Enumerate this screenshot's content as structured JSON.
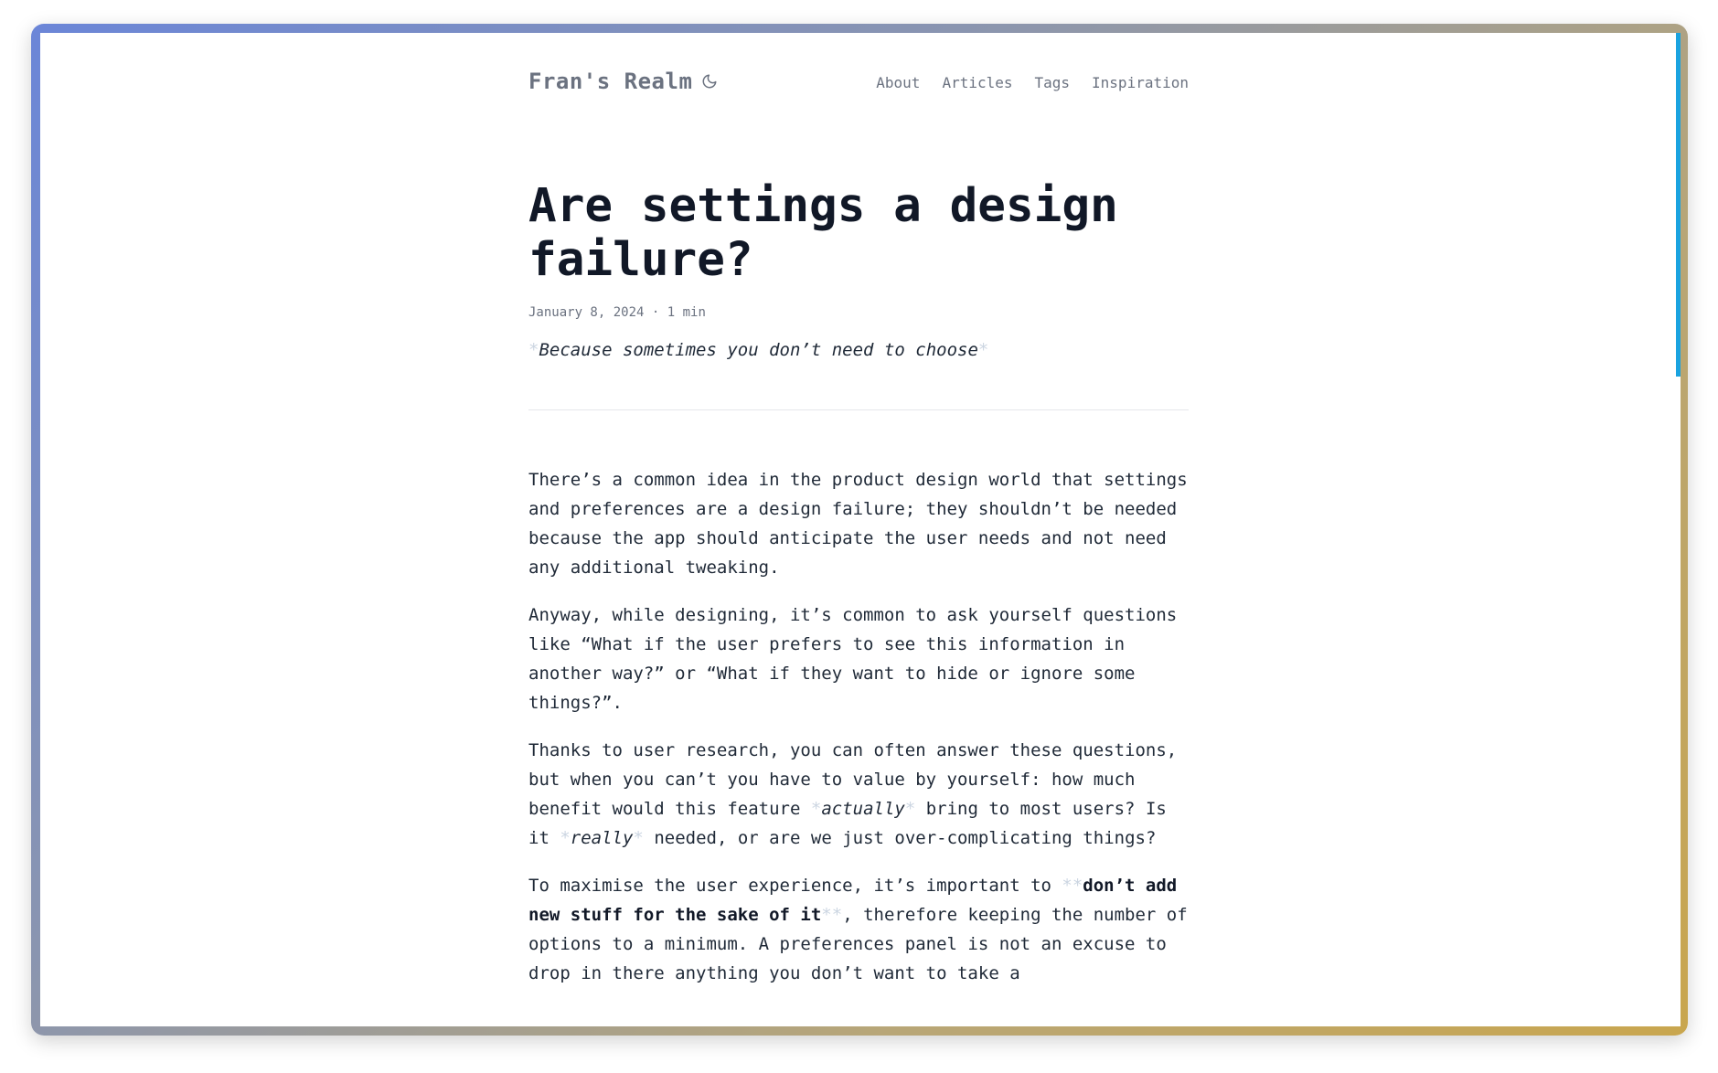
{
  "site": {
    "title": "Fran's Realm",
    "theme_toggle_icon": "moon-icon"
  },
  "nav": {
    "items": [
      "About",
      "Articles",
      "Tags",
      "Inspiration"
    ]
  },
  "article": {
    "title": "Are settings a design failure?",
    "date": "January 8, 2024",
    "separator": "·",
    "read_time": "1 min",
    "subtitle": "Because sometimes you don’t need to choose",
    "paragraphs": {
      "p1": "There’s a common idea in the product design world that settings and preferences are a design failure; they shouldn’t be needed because the app should anticipate the user needs and not need any additional tweaking.",
      "p2": "Anyway, while designing, it’s common to ask yourself questions like “What if the user prefers to see this information in another way?” or “What if they want to hide or ignore some things?”.",
      "p3_a": "Thanks to user research, you can often answer these questions, but when you can’t you have to value by yourself: how much benefit would this feature ",
      "p3_em1": "actually",
      "p3_b": " bring to most users? Is it ",
      "p3_em2": "really",
      "p3_c": " needed, or are we just over-complicating things?",
      "p4_a": "To maximise the user experience, it’s important to ",
      "p4_strong": "don’t add new stuff for the sake of it",
      "p4_b": ", therefore keeping the number of options to a minimum. A preferences panel is not an excuse to drop in there anything you don’t want to take a"
    },
    "markers": {
      "italic": "*",
      "bold": "**"
    }
  },
  "colors": {
    "frame_gradient_start": "#6b86d8",
    "frame_gradient_end": "#c9a64e",
    "scrollbar": "#1aa3e0",
    "text": "#1f2937",
    "muted": "#6b7280"
  }
}
